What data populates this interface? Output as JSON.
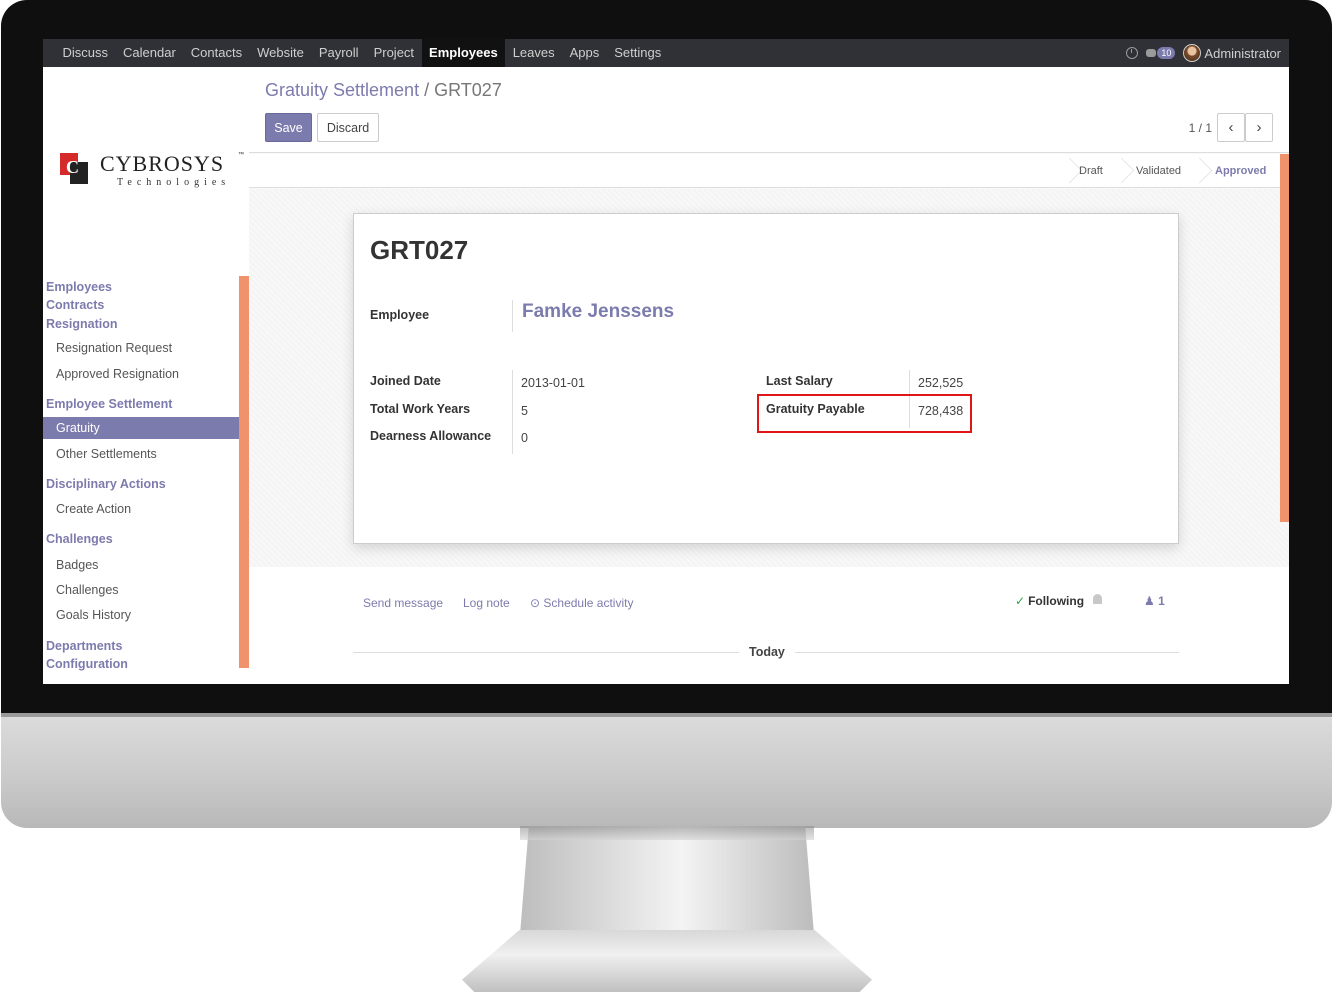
{
  "topbar": {
    "menu": [
      "Discuss",
      "Calendar",
      "Contacts",
      "Website",
      "Payroll",
      "Project",
      "Employees",
      "Leaves",
      "Apps",
      "Settings"
    ],
    "active": "Employees",
    "message_count": "10",
    "user": "Administrator"
  },
  "sidebar": {
    "logo": {
      "name": "CYBROSYS",
      "tm": "™",
      "sub": "Technologies"
    },
    "items": [
      {
        "label": "Employees"
      },
      {
        "label": "Contracts"
      },
      {
        "label": "Resignation"
      },
      {
        "label": "Resignation Request"
      },
      {
        "label": "Approved Resignation"
      },
      {
        "label": "Employee Settlement"
      },
      {
        "label": "Gratuity"
      },
      {
        "label": "Other Settlements"
      },
      {
        "label": "Disciplinary Actions"
      },
      {
        "label": "Create Action"
      },
      {
        "label": "Challenges"
      },
      {
        "label": "Badges"
      },
      {
        "label": "Challenges"
      },
      {
        "label": "Goals History"
      },
      {
        "label": "Departments"
      },
      {
        "label": "Configuration"
      }
    ],
    "selected": "Gratuity"
  },
  "control": {
    "breadcrumb_parent": "Gratuity Settlement",
    "breadcrumb_sep": "/",
    "breadcrumb_current": "GRT027",
    "save_label": "Save",
    "discard_label": "Discard",
    "pager": "1 / 1"
  },
  "status": {
    "stages": [
      "Draft",
      "Validated",
      "Approved"
    ],
    "current": "Approved"
  },
  "form": {
    "name": "GRT027",
    "employee_label": "Employee",
    "employee": "Famke Jenssens",
    "joined_date_label": "Joined Date",
    "joined_date": "2013-01-01",
    "total_work_years_label": "Total Work Years",
    "total_work_years": "5",
    "dearness_allowance_label": "Dearness Allowance",
    "dearness_allowance": "0",
    "last_salary_label": "Last Salary",
    "last_salary": "252,525",
    "gratuity_payable_label": "Gratuity Payable",
    "gratuity_payable": "728,438"
  },
  "chatter": {
    "send_message": "Send message",
    "log_note": "Log note",
    "schedule_activity": "Schedule activity",
    "following": "Following",
    "followers_count": "1",
    "today": "Today"
  },
  "colors": {
    "accent": "#7c7bad",
    "orange": "#f0926c",
    "highlight": "#e01515"
  }
}
